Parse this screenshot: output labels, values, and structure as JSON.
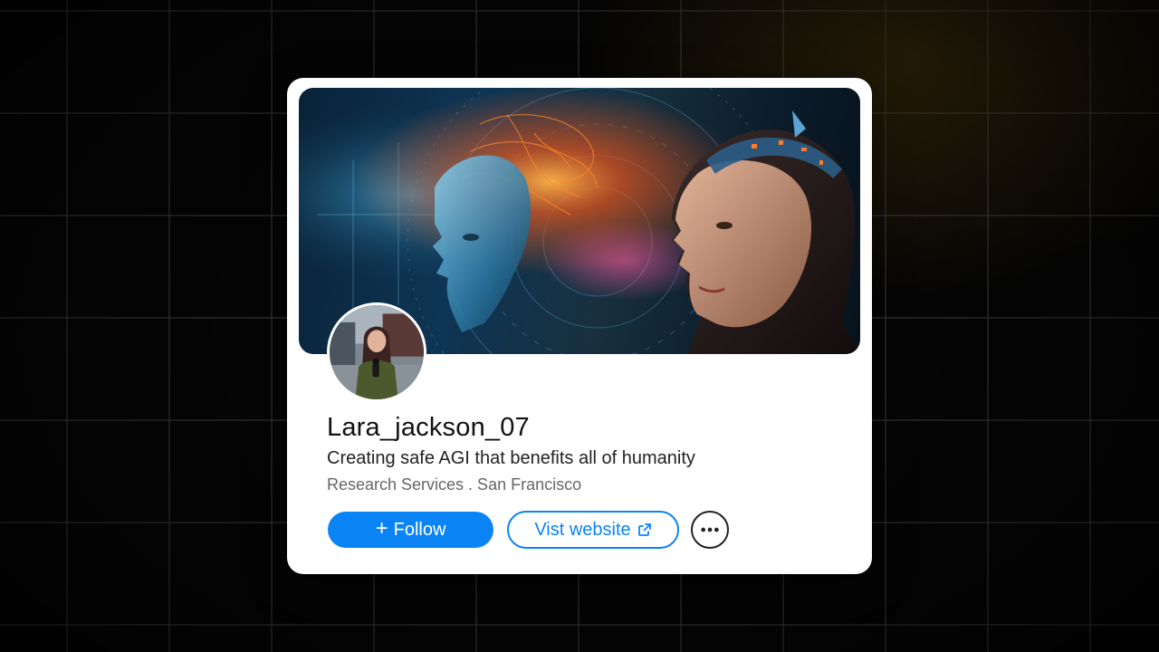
{
  "profile": {
    "username": "Lara_jackson_07",
    "headline": "Creating safe AGI that benefits all of humanity",
    "meta": "Research Services . San Francisco"
  },
  "actions": {
    "follow_label": "Follow",
    "follow_icon": "plus-icon",
    "website_label": "Vist website",
    "website_icon": "external-link-icon",
    "more_icon": "more-horizontal-icon"
  },
  "images": {
    "banner": "ai-head-and-woman-profile-artwork",
    "avatar": "woman-holding-microphone-photo"
  },
  "colors": {
    "accent": "#0a84f5",
    "card": "#ffffff",
    "background": "#050505"
  }
}
